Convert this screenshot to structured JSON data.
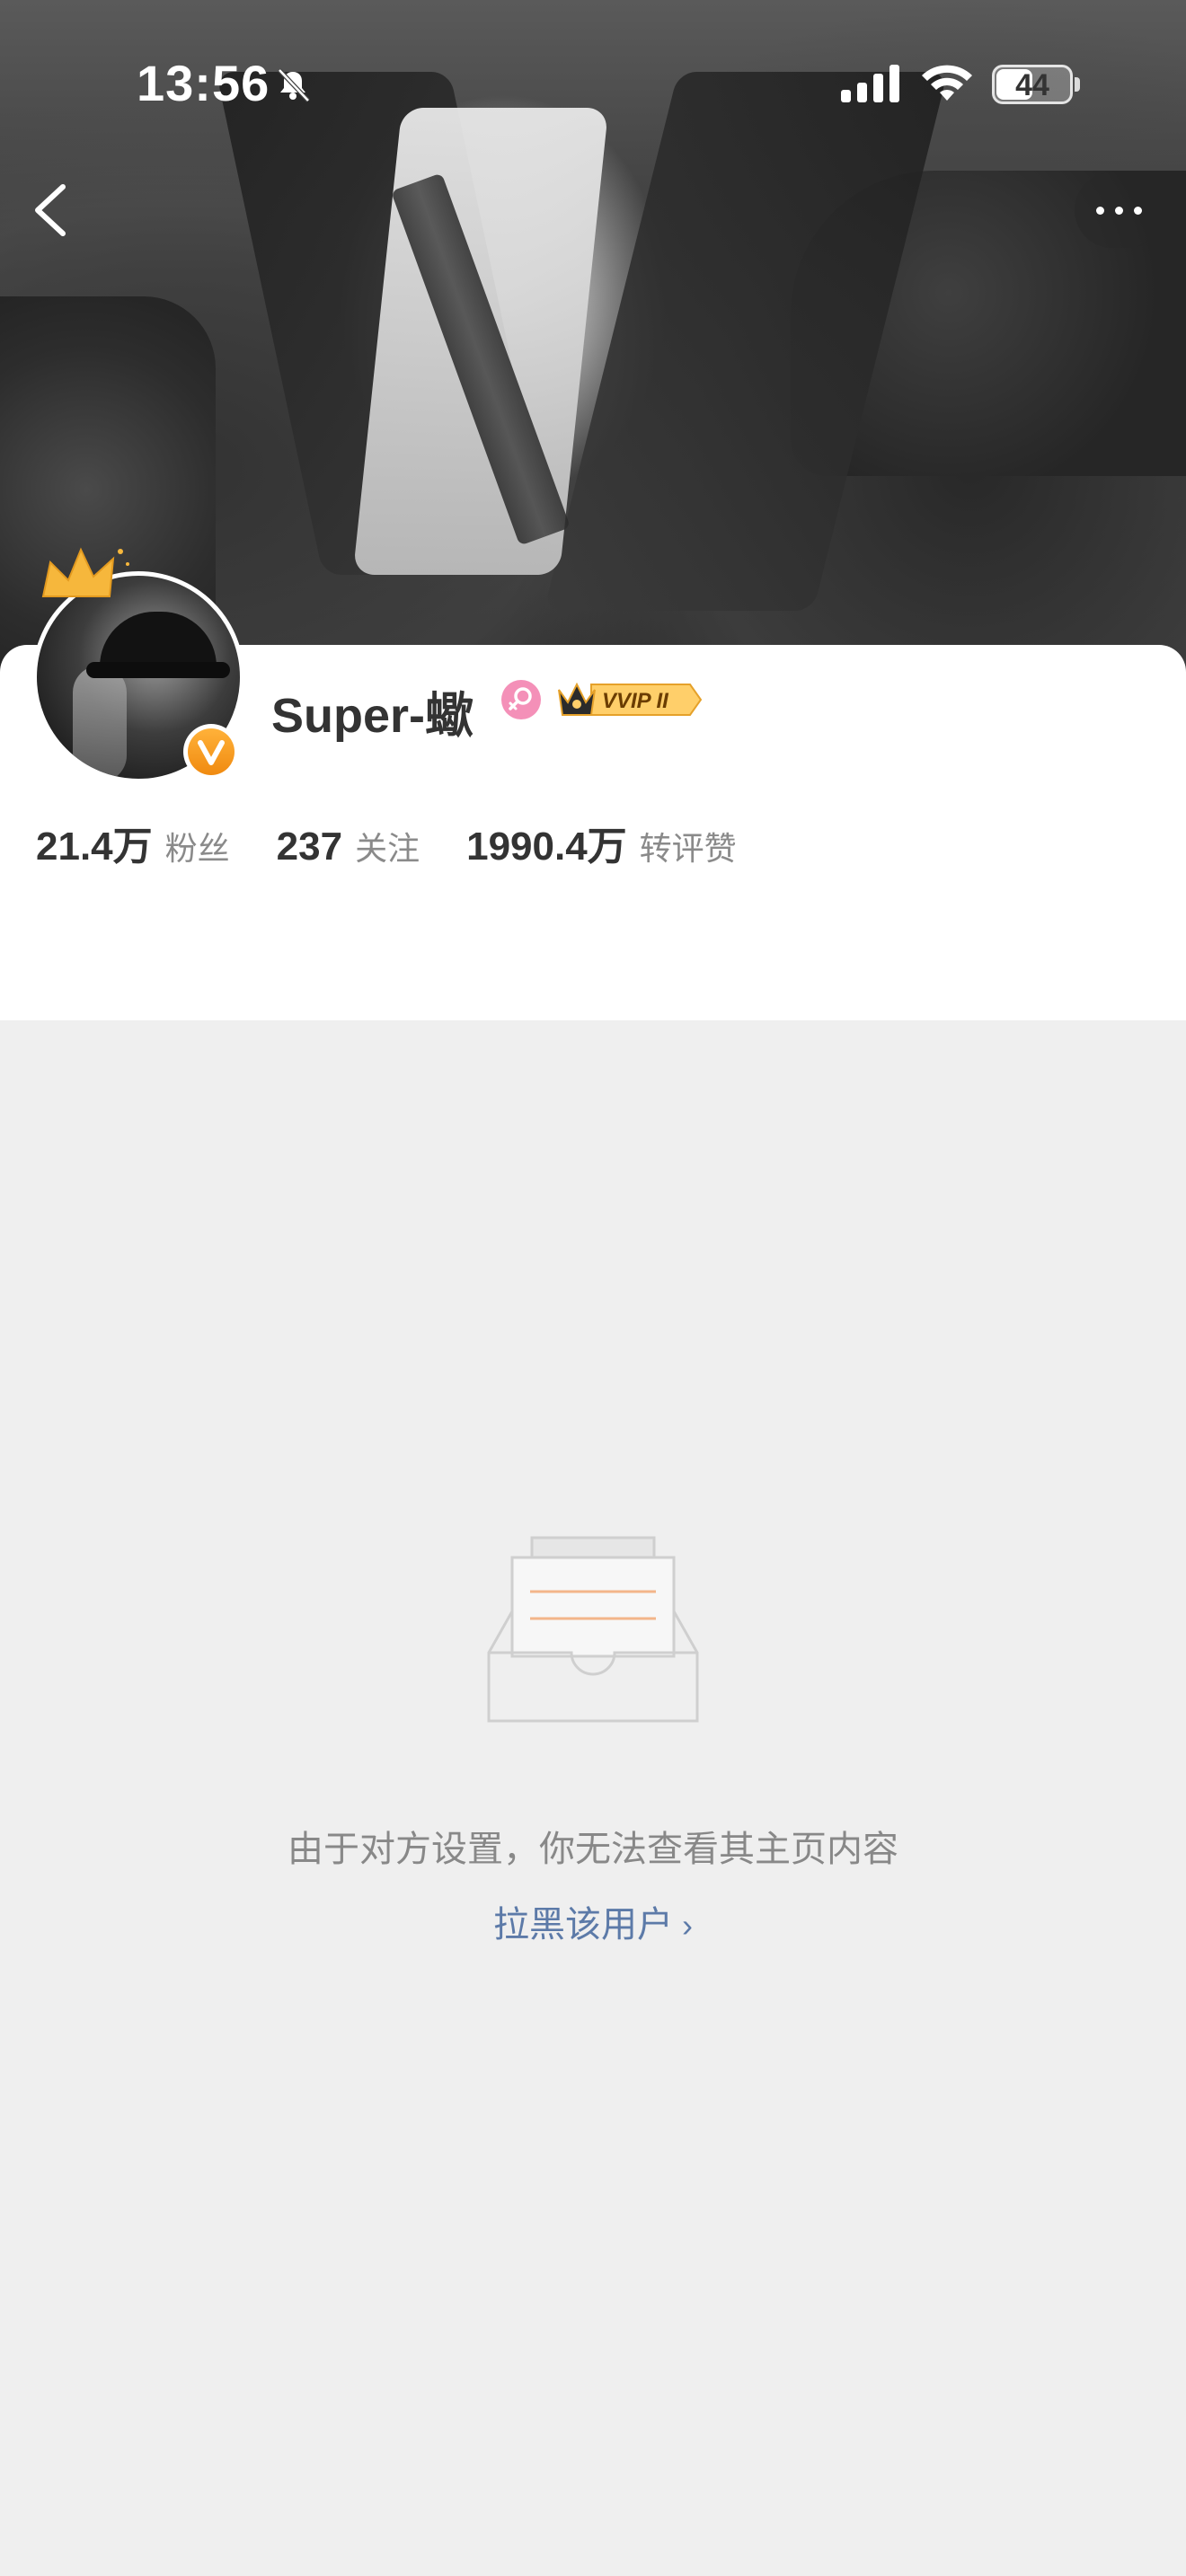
{
  "status_bar": {
    "time": "13:56",
    "battery": "44"
  },
  "profile": {
    "username": "Super-蠍",
    "vip_badge": "VVIP II",
    "stats": [
      {
        "value": "21.4万",
        "label": "粉丝"
      },
      {
        "value": "237",
        "label": "关注"
      },
      {
        "value": "1990.4万",
        "label": "转评赞"
      }
    ]
  },
  "empty_state": {
    "message": "由于对方设置，你无法查看其主页内容",
    "block_link": "拉黑该用户",
    "link_color": "#5c7aa8"
  },
  "icons": {
    "back": "back-arrow-icon",
    "more": "more-icon",
    "gender": "female-icon",
    "verified": "verified-v-icon",
    "crown": "crown-icon",
    "empty": "empty-inbox-icon"
  }
}
